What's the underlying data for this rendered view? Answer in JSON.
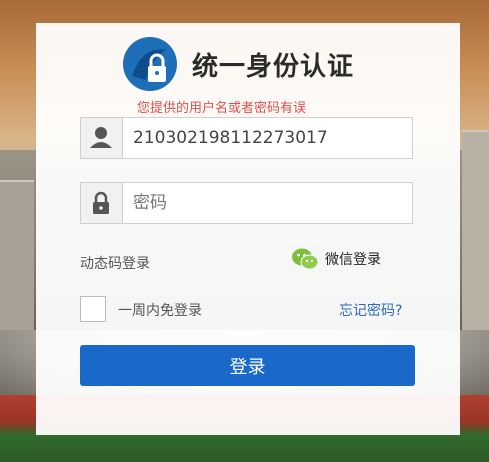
{
  "header": {
    "title": "统一身份认证",
    "error_message": "您提供的用户名或者密码有误"
  },
  "form": {
    "username_value": "210302198112273017",
    "password_placeholder": "密码",
    "dynamic_code_login": "动态码登录",
    "wechat_login": "微信登录",
    "remember_label": "一周内免登录",
    "forgot_password": "忘记密码?",
    "submit_label": "登录"
  },
  "colors": {
    "accent": "#1a68c9",
    "error": "#e0504a",
    "link": "#2a6ab8",
    "wechat": "#7bbf3a"
  },
  "icons": [
    "logo-lock-icon",
    "user-icon",
    "lock-icon",
    "wechat-icon"
  ]
}
